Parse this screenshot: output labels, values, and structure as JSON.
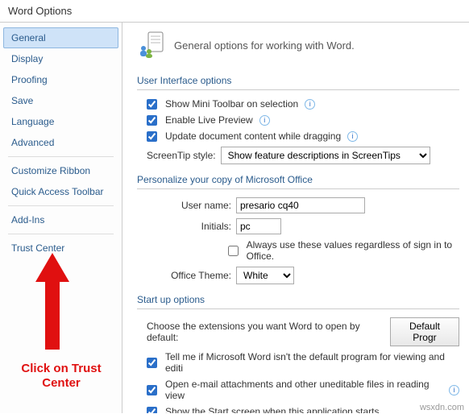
{
  "title": "Word Options",
  "sidebar": {
    "items": [
      "General",
      "Display",
      "Proofing",
      "Save",
      "Language",
      "Advanced",
      "Customize Ribbon",
      "Quick Access Toolbar",
      "Add-Ins",
      "Trust Center"
    ]
  },
  "header_text": "General options for working with Word.",
  "sections": {
    "ui": {
      "title": "User Interface options",
      "mini_toolbar": "Show Mini Toolbar on selection",
      "live_preview": "Enable Live Preview",
      "update_content": "Update document content while dragging",
      "screentip_label": "ScreenTip style:",
      "screentip_value": "Show feature descriptions in ScreenTips"
    },
    "personal": {
      "title": "Personalize your copy of Microsoft Office",
      "username_label": "User name:",
      "username_value": "presario cq40",
      "initials_label": "Initials:",
      "initials_value": "pc",
      "always_use": "Always use these values regardless of sign in to Office.",
      "theme_label": "Office Theme:",
      "theme_value": "White"
    },
    "startup": {
      "title": "Start up options",
      "choose_ext": "Choose the extensions you want Word to open by default:",
      "default_btn": "Default Progr",
      "tell_me": "Tell me if Microsoft Word isn't the default program for viewing and editi",
      "open_email": "Open e-mail attachments and other uneditable files in reading view",
      "show_start": "Show the Start screen when this application starts"
    }
  },
  "annotation": "Click on Trust Center",
  "watermark": "wsxdn.com"
}
